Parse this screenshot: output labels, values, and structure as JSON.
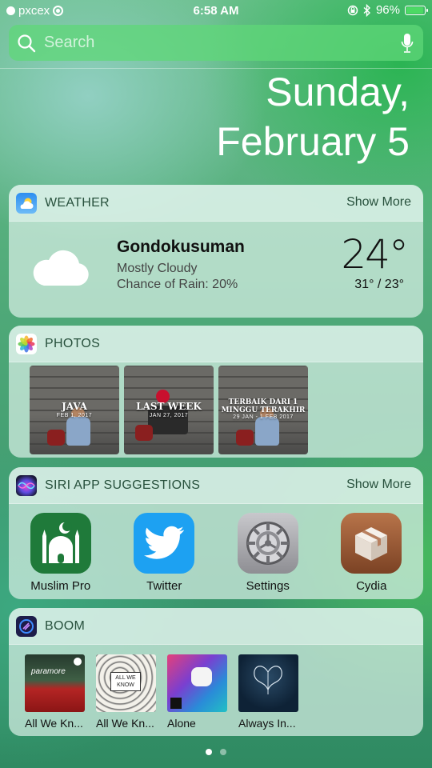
{
  "status_bar": {
    "carrier": "pxcex",
    "time": "6:58 AM",
    "battery": "96%",
    "battery_level": 0.96
  },
  "search": {
    "placeholder": "Search"
  },
  "date": {
    "line1": "Sunday,",
    "line2": "February 5"
  },
  "weather_widget": {
    "title": "WEATHER",
    "show_more": "Show More",
    "city": "Gondokusuman",
    "condition": "Mostly Cloudy",
    "rain": "Chance of Rain: 20%",
    "temperature": "24°",
    "range": "31° / 23°",
    "icon": "cloud-icon"
  },
  "photos_widget": {
    "title": "PHOTOS",
    "items": [
      {
        "title": "JAVA",
        "date": "FEB 1, 2017"
      },
      {
        "title": "LAST WEEK",
        "date": "JAN 27, 2017"
      },
      {
        "title": "TERBAIK DARI 1 MINGGU TERAKHIR",
        "date": "29 JAN - 1 FEB 2017"
      }
    ]
  },
  "siri_widget": {
    "title": "SIRI APP SUGGESTIONS",
    "show_more": "Show More",
    "apps": [
      {
        "label": "Muslim Pro",
        "icon": "muslim-pro-icon",
        "color": "#1f7a3a"
      },
      {
        "label": "Twitter",
        "icon": "twitter-icon",
        "color": "#1da1f2"
      },
      {
        "label": "Settings",
        "icon": "settings-icon",
        "color": "#8e8e93"
      },
      {
        "label": "Cydia",
        "icon": "cydia-icon",
        "color": "#9b5a33"
      }
    ]
  },
  "boom_widget": {
    "title": "BOOM",
    "albums": [
      {
        "label": "All We Kn...",
        "art_text": "paramore"
      },
      {
        "label": "All We Kn...",
        "art_text": "ALL WE KNOW"
      },
      {
        "label": "Alone"
      },
      {
        "label": "Always In..."
      }
    ]
  },
  "page_indicator": {
    "pages": 2,
    "current": 1
  }
}
